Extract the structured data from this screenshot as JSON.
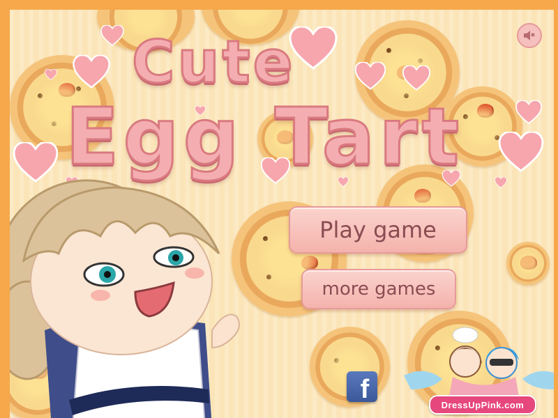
{
  "game": {
    "title_line1": "Cute",
    "title_line2": "Egg Tart"
  },
  "menu": {
    "play_label": "Play game",
    "more_label": "more games"
  },
  "social": {
    "facebook_glyph": "f"
  },
  "sponsor": {
    "logo_text": "DressUpPink.com"
  },
  "colors": {
    "background_border": "#f6a84a",
    "board": "#fbe5b8",
    "title_fill": "#f4aeb1",
    "title_outline": "#d97a80",
    "button_fill": "#f9c7c0",
    "button_text": "#8a4c52",
    "heart": "#f7a6ae"
  },
  "icons": {
    "sound": "speaker-muted-icon",
    "facebook": "facebook-icon"
  }
}
